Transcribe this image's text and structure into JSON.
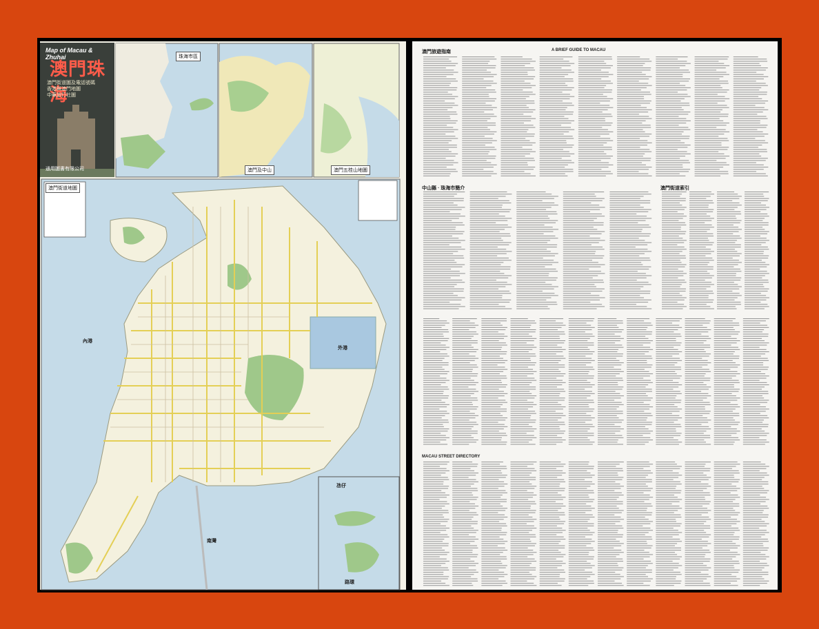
{
  "cover": {
    "title_en": "Map of Macau & Zhuhai",
    "title_zh": "澳門珠海",
    "subtitle_lines": [
      "澳門街道圖及電話號碼",
      "香港與澳門地圖",
      "中華旅行社圖"
    ],
    "publisher": "通用圖書有限公司"
  },
  "insets": {
    "zhuhai_city": "珠海市區",
    "macau_region": "澳門及中山",
    "pearl_delta": "澳門五桂山地圖",
    "taipa": "氹仔",
    "coloane": "路環"
  },
  "main_map": {
    "legend_title": "澳門街道地圖",
    "sea_labels": [
      "南灣",
      "外港",
      "內港"
    ]
  },
  "text_sheet": {
    "header_1": "澳門旅遊指南",
    "header_2": "中山縣 · 珠海市簡介",
    "header_3": "A BRIEF GUIDE TO MACAU",
    "index_header": "澳門街道索引",
    "street_directory": "MACAU STREET DIRECTORY"
  },
  "colors": {
    "background": "#d8460f",
    "sea": "#c5dbe8",
    "land": "#f3f1e6",
    "park": "#9fc88a",
    "road": "#e8d86a"
  }
}
